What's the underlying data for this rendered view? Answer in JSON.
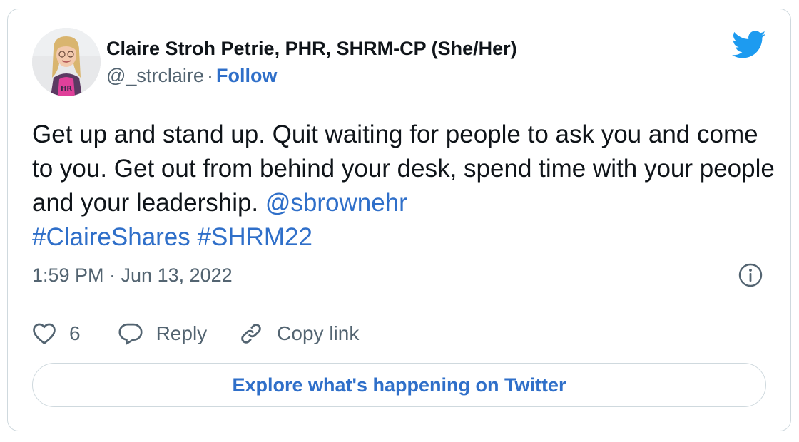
{
  "author": {
    "name": "Claire Stroh Petrie, PHR, SHRM-CP (She/Her)",
    "handle": "@_strclaire",
    "separator": "·",
    "follow_label": "Follow",
    "avatar_shirt_text": "HR"
  },
  "brand_icon": "twitter-bird-icon",
  "tweet": {
    "text": "Get up and stand up. Quit waiting for people to ask you and come to you. Get out from behind your desk, spend time with your people and your leadership. ",
    "mention": "@sbrownehr",
    "hashtags": [
      "#ClaireShares",
      "#SHRM22"
    ],
    "timestamp": "1:59 PM · Jun 13, 2022"
  },
  "actions": {
    "like_icon": "heart-icon",
    "like_count": "6",
    "reply_icon": "speech-bubble-icon",
    "reply_label": "Reply",
    "copy_icon": "link-icon",
    "copy_label": "Copy link",
    "info_icon": "info-icon"
  },
  "explore_label": "Explore what's happening on Twitter",
  "colors": {
    "link": "#2f6fc9",
    "brand": "#1d9bf0",
    "text": "#0f1419",
    "muted": "#536471",
    "border": "#cfd9de"
  }
}
